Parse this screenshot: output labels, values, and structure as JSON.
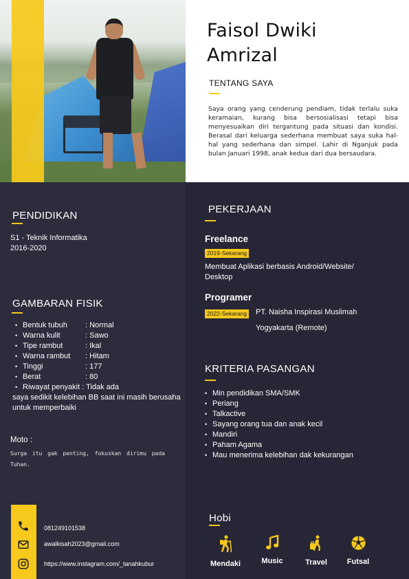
{
  "header": {
    "name_line1": "Faisol Dwiki",
    "name_line2": "Amrizal",
    "about_title": "TENTANG SAYA",
    "about_text": "Saya orang yang cenderung pendiam, tidak terlalu suka keramaian, kurang bisa bersosialisasi tetapi bisa menyesuaikan diri tergantung pada situasi dan kondisi. Berasal dari keluarga sederhana membuat saya suka hal-hal yang sederhana dan simpel. Lahir di Nganjuk pada bulan Januari 1998, anak kedua dari dua bersaudara."
  },
  "education": {
    "title": "PENDIDIKAN",
    "degree": "S1 - Teknik Informatika",
    "years": "2016-2020"
  },
  "physical": {
    "title": "GAMBARAN FISIK",
    "items": [
      {
        "key": "Bentuk tubuh",
        "value": ": Normal"
      },
      {
        "key": "Warna kulit",
        "value": ": Sawo"
      },
      {
        "key": "Tipe rambut",
        "value": ": Ikal"
      },
      {
        "key": "Warna rambut",
        "value": ": Hitam"
      },
      {
        "key": "Tinggi",
        "value": ": 177"
      },
      {
        "key": "Berat",
        "value": ": 80"
      },
      {
        "key": "Riwayat penyakit",
        "value": ": Tidak ada"
      }
    ],
    "note": "saya sedikit kelebihan BB saat ini masih berusaha untuk memperbaiki"
  },
  "moto": {
    "label": "Moto :",
    "text": "Surga itu gak penting, fokuskan dirimu pada Tuhan."
  },
  "contact": {
    "phone": "081249101538",
    "email": "awalkisah2023@gmail.com",
    "instagram": "https://www.instagram.com/_tanahkubur"
  },
  "work": {
    "title": "PEKERJAAN",
    "jobs": [
      {
        "title": "Freelance",
        "period": "2019-Sekarang",
        "desc_line1": "Membuat Aplikasi berbasis Android/Website/",
        "desc_line2": "Desktop"
      },
      {
        "title": "Programer",
        "period": "2022-Sekarang",
        "desc_line1": "PT. Naisha Inspirasi Muslimah",
        "desc_line2": "Yogyakarta (Remote)"
      }
    ]
  },
  "partner": {
    "title": "KRITERIA PASANGAN",
    "items": [
      "Min pendidikan SMA/SMK",
      "Periang",
      "Talkactive",
      "Sayang orang tua dan anak kecil",
      "Mandiri",
      "Paham Agama",
      "Mau menerima kelebihan dak kekurangan"
    ]
  },
  "hobbies": {
    "title": "Hobi",
    "items": [
      {
        "label": "Mendaki",
        "icon": "hiking-icon"
      },
      {
        "label": "Music",
        "icon": "music-note-icon"
      },
      {
        "label": "Travel",
        "icon": "traveler-icon"
      },
      {
        "label": "Futsal",
        "icon": "soccer-ball-icon"
      }
    ]
  },
  "colors": {
    "accent": "#f6c91c",
    "panel_left": "#2c2c3d",
    "panel_right": "#262636"
  }
}
